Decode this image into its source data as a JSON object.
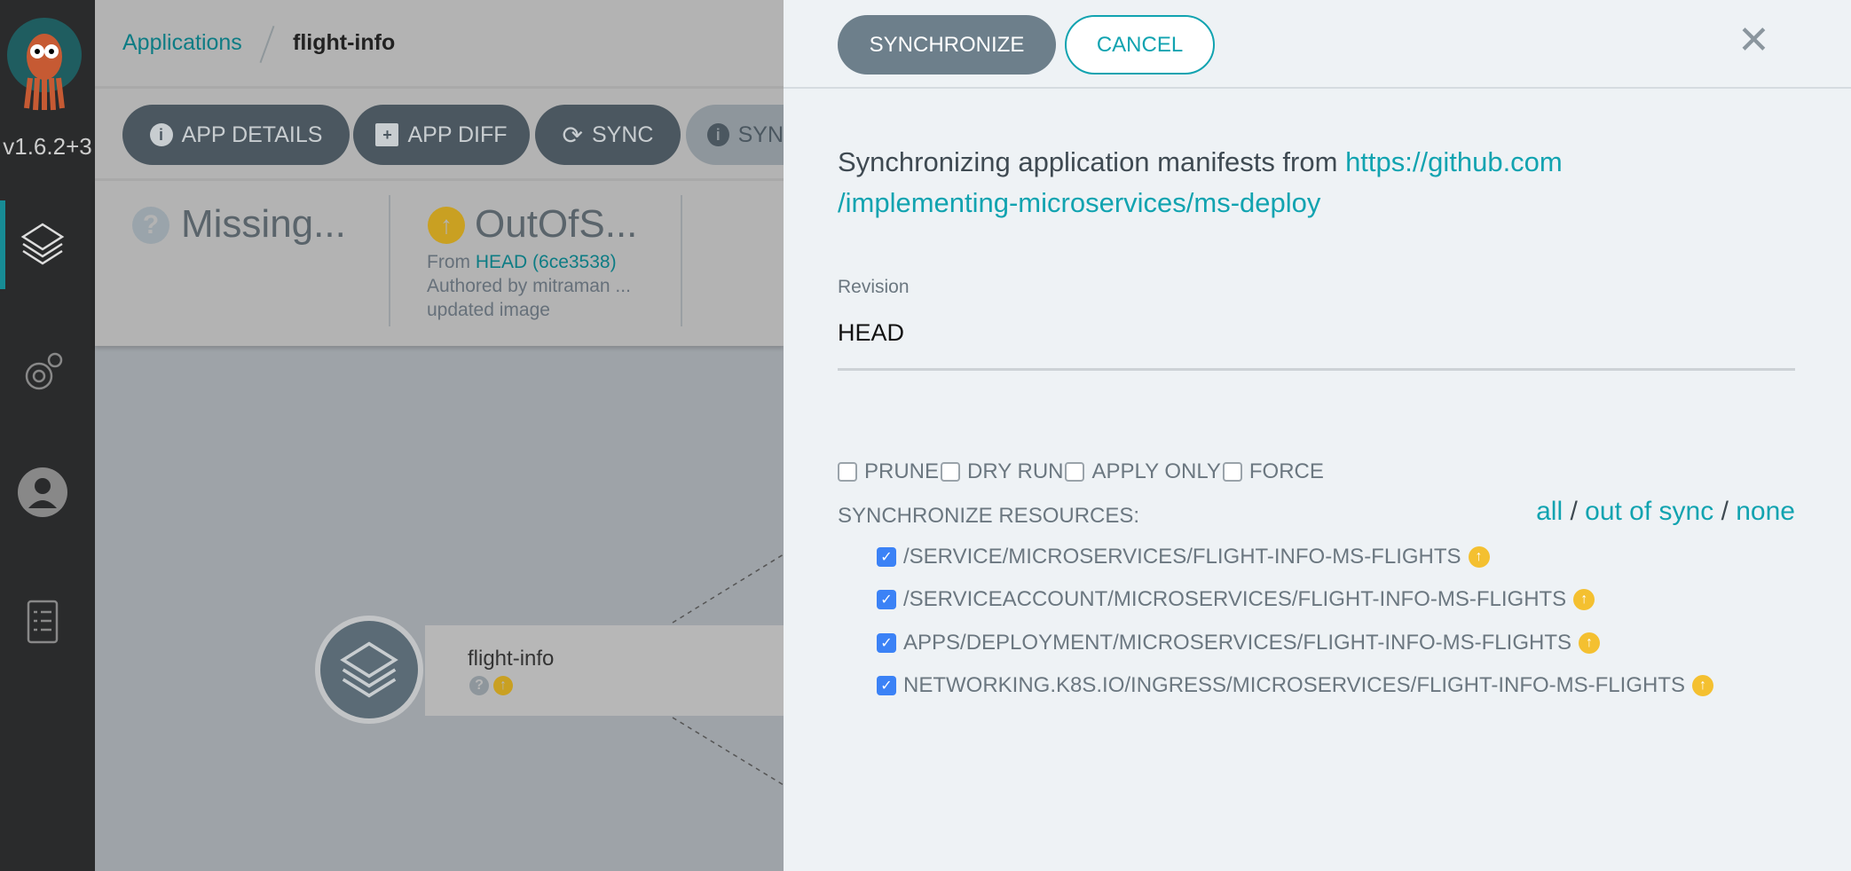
{
  "sidebar": {
    "version": "v1.6.2+3",
    "items": [
      "applications",
      "settings",
      "user-info",
      "docs"
    ]
  },
  "breadcrumb": {
    "root": "Applications",
    "current": "flight-info"
  },
  "toolbar": {
    "app_details": "APP DETAILS",
    "app_diff": "APP DIFF",
    "sync": "SYNC",
    "sync_status": "SYN"
  },
  "status": {
    "health": "Missing...",
    "sync": "OutOfS...",
    "from_label": "From",
    "revision": "HEAD (6ce3538)",
    "author": "Authored by mitraman ...",
    "message": "updated image"
  },
  "graph": {
    "node_name": "flight-info"
  },
  "panel": {
    "synchronize": "SYNCHRONIZE",
    "cancel": "CANCEL",
    "intro": "Synchronizing application manifests from",
    "repo_line1": "https://github.com",
    "repo_line2": "/implementing-microservices/ms-deploy",
    "revision_label": "Revision",
    "revision_value": "HEAD",
    "options": [
      "PRUNE",
      "DRY RUN",
      "APPLY ONLY",
      "FORCE"
    ],
    "resources_label": "SYNCHRONIZE RESOURCES:",
    "select_all": "all",
    "select_out_of_sync": "out of sync",
    "select_none": "none",
    "sep": "/",
    "resources": [
      "/SERVICE/MICROSERVICES/FLIGHT-INFO-MS-FLIGHTS",
      "/SERVICEACCOUNT/MICROSERVICES/FLIGHT-INFO-MS-FLIGHTS",
      "APPS/DEPLOYMENT/MICROSERVICES/FLIGHT-INFO-MS-FLIGHTS",
      "NETWORKING.K8S.IO/INGRESS/MICROSERVICES/FLIGHT-INFO-MS-FLIGHTS"
    ]
  },
  "colors": {
    "accent": "#11a3b0",
    "out_of_sync": "#f4c030",
    "checkbox": "#3b82f6"
  }
}
